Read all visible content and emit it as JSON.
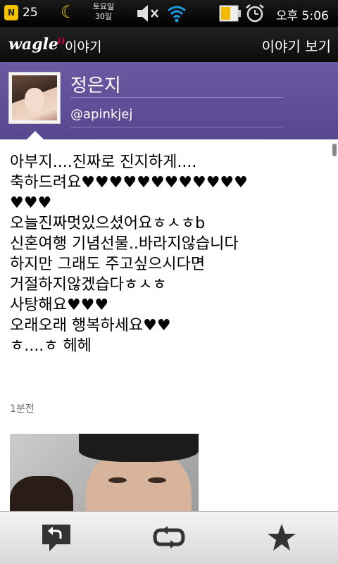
{
  "status_bar": {
    "app_icon_letter": "N",
    "count": "25",
    "date_line1": "토요일",
    "date_line2": "30일",
    "time": "오후 5:06"
  },
  "header": {
    "logo": "wagle",
    "logo_sub": "이야기",
    "view_button": "이야기 보기"
  },
  "profile": {
    "name": "정은지",
    "handle": "@apinkjej"
  },
  "post": {
    "text": "아부지....진짜로 진지하게....\n축하드려요♥♥♥♥♥♥♥♥♥♥♥♥\n♥♥♥\n오늘진짜멋있으셨어요ㅎㅅㅎb\n신혼여행 기념선물..바라지않습니다\n하지만 그래도 주고싶으시다면\n거절하지않겠습다ㅎㅅㅎ\n사탕해요♥♥♥\n오래오래 행복하세요♥♥\nㅎ....ㅎ 헤헤",
    "timestamp": "1분전"
  },
  "toolbar": {
    "reply_icon": "reply-icon",
    "retweet_icon": "retweet-icon",
    "favorite_icon": "star-icon"
  },
  "colors": {
    "profile_bg": "#5e4f96",
    "accent": "#e6004c"
  }
}
